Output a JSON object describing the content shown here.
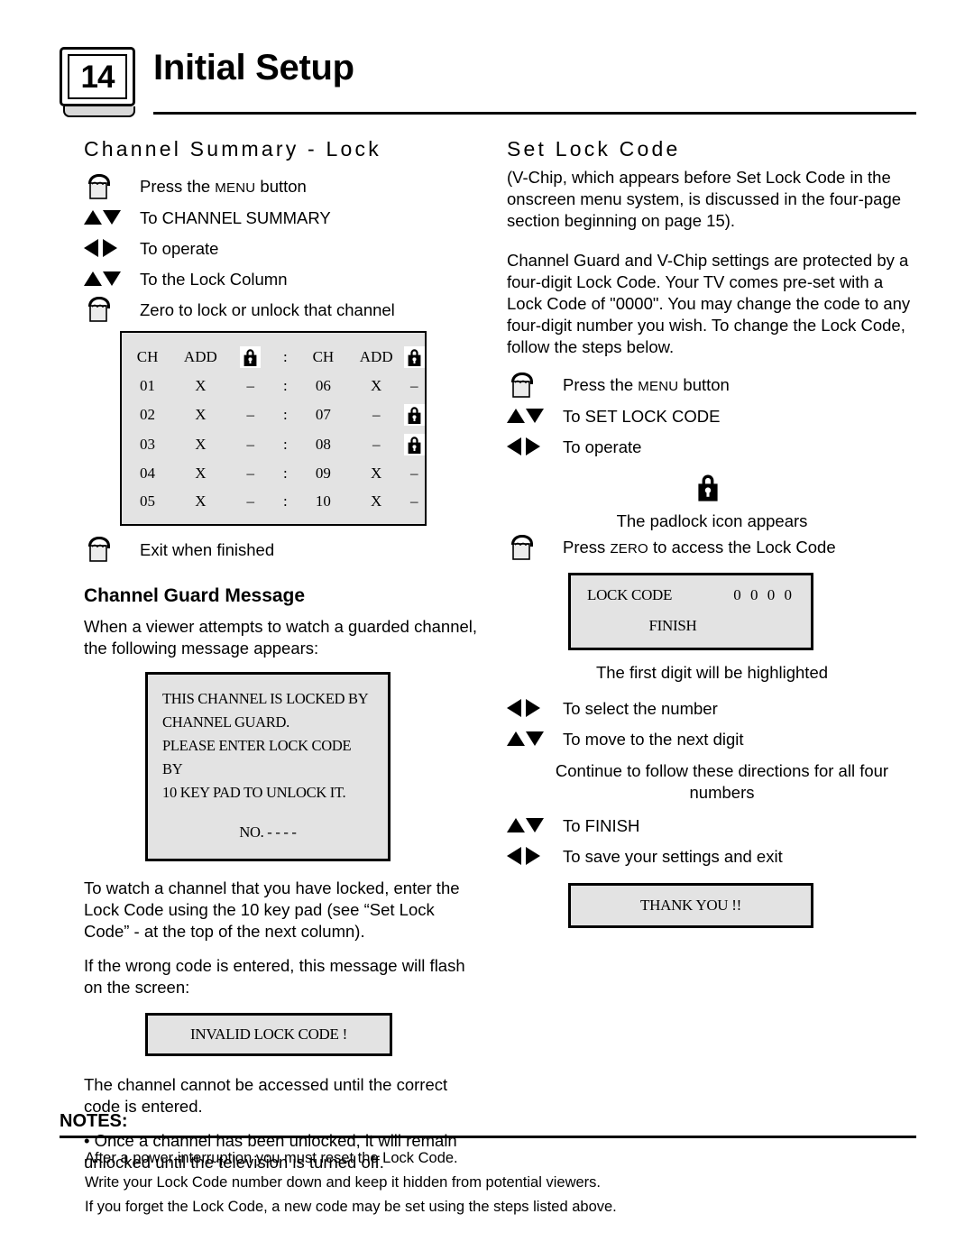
{
  "header": {
    "page_number": "14",
    "title": "Initial Setup"
  },
  "left": {
    "heading": "Channel Summary - Lock",
    "steps": [
      {
        "icon": "hand-press-icon",
        "text_pre": "Press the ",
        "smallcaps": "MENU",
        "text_post": " button"
      },
      {
        "icon": "up-down-arrows-icon",
        "text": "To CHANNEL SUMMARY"
      },
      {
        "icon": "left-right-arrows-icon",
        "text": "To operate"
      },
      {
        "icon": "up-down-arrows-icon",
        "text": "To the Lock Column"
      },
      {
        "icon": "hand-press-icon",
        "text": "Zero to lock or unlock that channel"
      }
    ],
    "table": {
      "headers": [
        "CH",
        "ADD",
        "lock-icon",
        ":",
        "CH",
        "ADD",
        "lock-icon"
      ],
      "rows": [
        [
          "01",
          "X",
          "–",
          ":",
          "06",
          "X",
          "–"
        ],
        [
          "02",
          "X",
          "–",
          ":",
          "07",
          "–",
          "lock-icon"
        ],
        [
          "03",
          "X",
          "–",
          ":",
          "08",
          "–",
          "lock-icon"
        ],
        [
          "04",
          "X",
          "–",
          ":",
          "09",
          "X",
          "–"
        ],
        [
          "05",
          "X",
          "–",
          ":",
          "10",
          "X",
          "–"
        ]
      ]
    },
    "exit_step": {
      "icon": "hand-press-icon",
      "text": "Exit when finished"
    },
    "guard_heading": "Channel Guard Message",
    "guard_intro": "When a viewer attempts to watch a guarded channel, the following message appears:",
    "osd_guard": {
      "lines": [
        "THIS CHANNEL IS LOCKED BY",
        "CHANNEL GUARD.",
        "PLEASE ENTER LOCK CODE BY",
        "10  KEY PAD TO UNLOCK IT."
      ],
      "no_line": "NO.  -  -  -  -"
    },
    "para_watch": "To watch a channel that you have locked, enter the Lock Code using the 10 key pad (see “Set Lock Code” - at the top of the next column).",
    "para_wrong": "If the wrong code is entered, this message will flash on the screen:",
    "osd_invalid": "INVALID LOCK CODE !",
    "para_cannot": "The channel cannot be accessed until the correct code is entered.",
    "para_once": "• Once a channel has been unlocked, it will remain unlocked until the television is turned off."
  },
  "right": {
    "heading": "Set Lock Code",
    "para_vchip": "(V-Chip, which appears before Set Lock Code in the onscreen menu system, is discussed in the four-page section beginning on page 15).",
    "para_protected": "Channel Guard and V-Chip settings are protected by a four-digit Lock Code. Your TV comes pre-set with a Lock Code of \"0000\". You may change the code to any four-digit number you wish. To change the Lock Code, follow the steps below.",
    "steps_top": [
      {
        "icon": "hand-press-icon",
        "text_pre": "Press the ",
        "smallcaps": "MENU",
        "text_post": " button"
      },
      {
        "icon": "up-down-arrows-icon",
        "text": "To SET LOCK CODE"
      },
      {
        "icon": "left-right-arrows-icon",
        "text": "To operate"
      }
    ],
    "padlock_caption": "The padlock icon appears",
    "zero_step": {
      "icon": "hand-press-icon",
      "text_pre": "Press ",
      "smallcaps": "ZERO",
      "text_post": " to access the Lock Code"
    },
    "osd_lockcode": {
      "label": "LOCK CODE",
      "digits": "0 0 0 0",
      "finish": "FINISH"
    },
    "first_digit_note": "The first digit will be highlighted",
    "steps_mid": [
      {
        "icon": "left-right-arrows-icon",
        "text": "To select the number"
      },
      {
        "icon": "up-down-arrows-icon",
        "text": "To move to the next digit"
      }
    ],
    "continue_note": "Continue to follow these directions for all four numbers",
    "steps_end": [
      {
        "icon": "up-down-arrows-icon",
        "text": "To FINISH"
      },
      {
        "icon": "left-right-arrows-icon",
        "text": "To save your settings and exit"
      }
    ],
    "osd_thanks": "THANK YOU !!"
  },
  "notes": {
    "label": "NOTES:",
    "items": [
      "After a power interruption you must reset the Lock Code.",
      "Write your Lock Code number down and keep it hidden from potential viewers.",
      "If you forget the Lock Code, a new code may be set using the steps listed above."
    ]
  }
}
